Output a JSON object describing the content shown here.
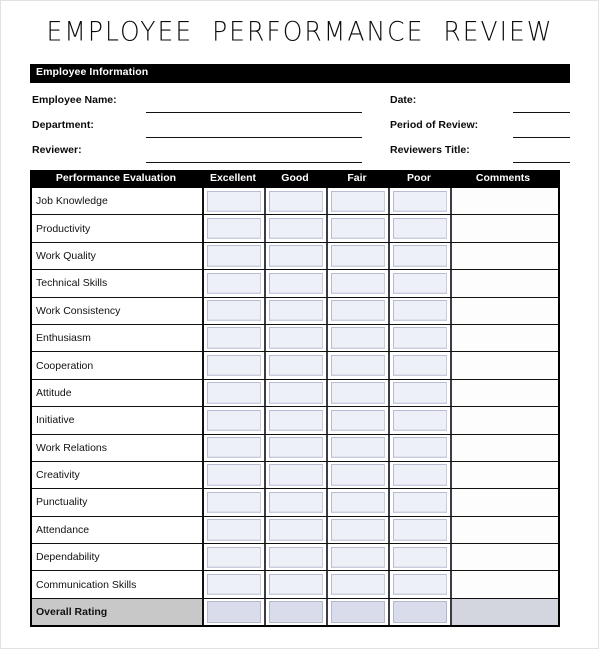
{
  "document": {
    "title": "EMPLOYEE PERFORMANCE REVIEW"
  },
  "employee_information": {
    "section_title": "Employee Information",
    "left_fields": [
      {
        "label": "Employee Name:",
        "value": ""
      },
      {
        "label": "Department:",
        "value": ""
      },
      {
        "label": "Reviewer:",
        "value": ""
      }
    ],
    "right_fields": [
      {
        "label": "Date:",
        "value": ""
      },
      {
        "label": "Period of Review:",
        "value": ""
      },
      {
        "label": "Reviewers Title:",
        "value": ""
      }
    ]
  },
  "evaluation_table": {
    "headers": [
      "Performance Evaluation",
      "Excellent",
      "Good",
      "Fair",
      "Poor",
      "Comments"
    ],
    "rows": [
      {
        "criterion": "Job Knowledge",
        "excellent": "",
        "good": "",
        "fair": "",
        "poor": "",
        "comments": ""
      },
      {
        "criterion": "Productivity",
        "excellent": "",
        "good": "",
        "fair": "",
        "poor": "",
        "comments": ""
      },
      {
        "criterion": "Work Quality",
        "excellent": "",
        "good": "",
        "fair": "",
        "poor": "",
        "comments": ""
      },
      {
        "criterion": "Technical Skills",
        "excellent": "",
        "good": "",
        "fair": "",
        "poor": "",
        "comments": ""
      },
      {
        "criterion": "Work Consistency",
        "excellent": "",
        "good": "",
        "fair": "",
        "poor": "",
        "comments": ""
      },
      {
        "criterion": "Enthusiasm",
        "excellent": "",
        "good": "",
        "fair": "",
        "poor": "",
        "comments": ""
      },
      {
        "criterion": "Cooperation",
        "excellent": "",
        "good": "",
        "fair": "",
        "poor": "",
        "comments": ""
      },
      {
        "criterion": "Attitude",
        "excellent": "",
        "good": "",
        "fair": "",
        "poor": "",
        "comments": ""
      },
      {
        "criterion": "Initiative",
        "excellent": "",
        "good": "",
        "fair": "",
        "poor": "",
        "comments": ""
      },
      {
        "criterion": "Work Relations",
        "excellent": "",
        "good": "",
        "fair": "",
        "poor": "",
        "comments": ""
      },
      {
        "criterion": "Creativity",
        "excellent": "",
        "good": "",
        "fair": "",
        "poor": "",
        "comments": ""
      },
      {
        "criterion": "Punctuality",
        "excellent": "",
        "good": "",
        "fair": "",
        "poor": "",
        "comments": ""
      },
      {
        "criterion": "Attendance",
        "excellent": "",
        "good": "",
        "fair": "",
        "poor": "",
        "comments": ""
      },
      {
        "criterion": "Dependability",
        "excellent": "",
        "good": "",
        "fair": "",
        "poor": "",
        "comments": ""
      },
      {
        "criterion": "Communication Skills",
        "excellent": "",
        "good": "",
        "fair": "",
        "poor": "",
        "comments": ""
      }
    ],
    "summary_row": {
      "criterion": "Overall Rating",
      "excellent": "",
      "good": "",
      "fair": "",
      "poor": "",
      "comments": ""
    }
  },
  "colors": {
    "header_bar": "#000000",
    "header_text": "#ffffff",
    "rating_cell_fill": "#eef0f8",
    "overall_label_fill": "#c8c8c8",
    "overall_cell_fill": "#d9dcea",
    "overall_comments_fill": "#d3d5df",
    "rule_line": "#111111",
    "page_background": "#ffffff"
  }
}
